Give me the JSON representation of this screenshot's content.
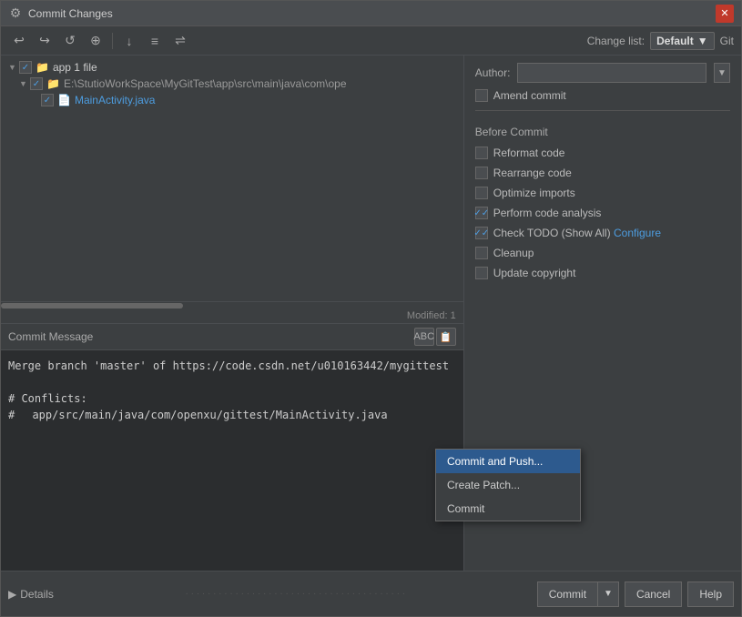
{
  "window": {
    "title": "Commit Changes",
    "icon": "⚙"
  },
  "toolbar": {
    "buttons": [
      "↩",
      "↪",
      "↺",
      "⊕",
      "↓",
      "≡",
      "⇌"
    ],
    "changelist_label": "Change list:",
    "changelist_value": "Default",
    "git_label": "Git"
  },
  "file_tree": {
    "items": [
      {
        "level": 0,
        "arrow": "▼",
        "check": "checked",
        "icon": "📁",
        "label": "app  1 file",
        "modified": false
      },
      {
        "level": 1,
        "arrow": "▼",
        "check": "checked",
        "icon": "📁",
        "label": "E:\\StutioWorkSpace\\MyGitTest\\app\\src\\main\\java\\com\\ope",
        "modified": false
      },
      {
        "level": 2,
        "arrow": "",
        "check": "checked",
        "icon": "📄",
        "label": "MainActivity.java",
        "modified": true
      }
    ],
    "modified_count": "Modified: 1"
  },
  "commit_message": {
    "label": "Commit Message",
    "toolbar_buttons": [
      "ABC",
      "📋"
    ],
    "text": "Merge branch 'master' of https://code.csdn.net/u010163442/mygittest\n\n# Conflicts:\n#   app/src/main/java/com/openxu/gittest/MainActivity.java"
  },
  "right_panel": {
    "author_label": "Author:",
    "author_value": "",
    "author_placeholder": "",
    "amend_commit_label": "Amend commit",
    "amend_commit_checked": false,
    "before_commit_header": "Before Commit",
    "options": [
      {
        "id": "reformat_code",
        "label": "Reformat code",
        "checked": false
      },
      {
        "id": "rearrange_code",
        "label": "Rearrange code",
        "checked": false
      },
      {
        "id": "optimize_imports",
        "label": "Optimize imports",
        "checked": false
      },
      {
        "id": "perform_code_analysis",
        "label": "Perform code analysis",
        "checked": true
      },
      {
        "id": "check_todo",
        "label": "Check TODO (Show All)  Configure",
        "checked": true
      },
      {
        "id": "cleanup",
        "label": "Cleanup",
        "checked": false
      },
      {
        "id": "update_copyright",
        "label": "Update copyright",
        "checked": false
      }
    ]
  },
  "details": {
    "label": "Details"
  },
  "dropdown_menu": {
    "items": [
      {
        "id": "commit_and_push",
        "label": "Commit and Push...",
        "highlighted": true
      },
      {
        "id": "create_patch",
        "label": "Create Patch..."
      },
      {
        "id": "commit",
        "label": "Commit"
      }
    ]
  },
  "bottom_buttons": {
    "commit_label": "Commit",
    "cancel_label": "Cancel",
    "help_label": "Help"
  }
}
